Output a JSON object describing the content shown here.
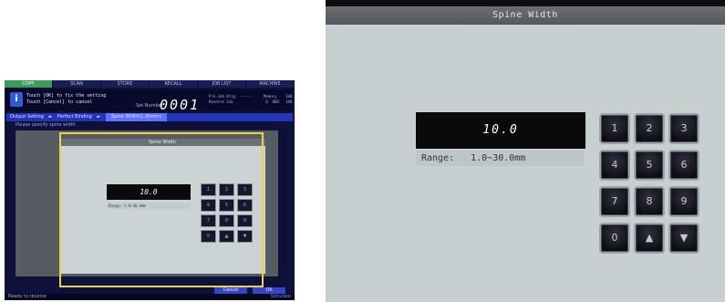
{
  "thumbnail": {
    "tabs": [
      "COPY",
      "SCAN",
      "STORE",
      "RECALL",
      "JOB LIST",
      "MACHINE"
    ],
    "message": "Touch [OK] to fix the setting\nTouch [Cancel] to cancel",
    "set_number_label": "Set Number",
    "set_number_value": "0001",
    "job_labels": "Pre-Job Orig  ------\nReserve Job",
    "job_values": "Memory    100.000%\n0  HDD   100.000%",
    "breadcrumb": [
      "Output Setting",
      "Perfect Binding",
      "Spine Width(1-30mm)"
    ],
    "prompt": "Please specify spine width",
    "dialog_title": "Spine Width",
    "display_value": "10.0",
    "range_text": "Range:  1.0~30.0mm",
    "keys": [
      "1",
      "2",
      "3",
      "4",
      "5",
      "6",
      "7",
      "8",
      "9",
      "0",
      "▲",
      "▼"
    ],
    "cancel_label": "Cancel",
    "ok_label": "OK",
    "status_left": "Ready to receive",
    "status_right": "Simulate"
  },
  "dialog": {
    "title": "Spine Width",
    "display_value": "10.0",
    "range_label": "Range:",
    "range_value": "1.0~30.0mm",
    "keys": [
      "1",
      "2",
      "3",
      "4",
      "5",
      "6",
      "7",
      "8",
      "9",
      "0",
      "▲",
      "▼"
    ]
  },
  "colors": {
    "highlight": "#f0cf4a",
    "panel_bg": "#0d1038",
    "dialog_bg": "#c8cfcf",
    "display_bg": "#0a0a0a",
    "active_tab": "#3f9b5c"
  }
}
